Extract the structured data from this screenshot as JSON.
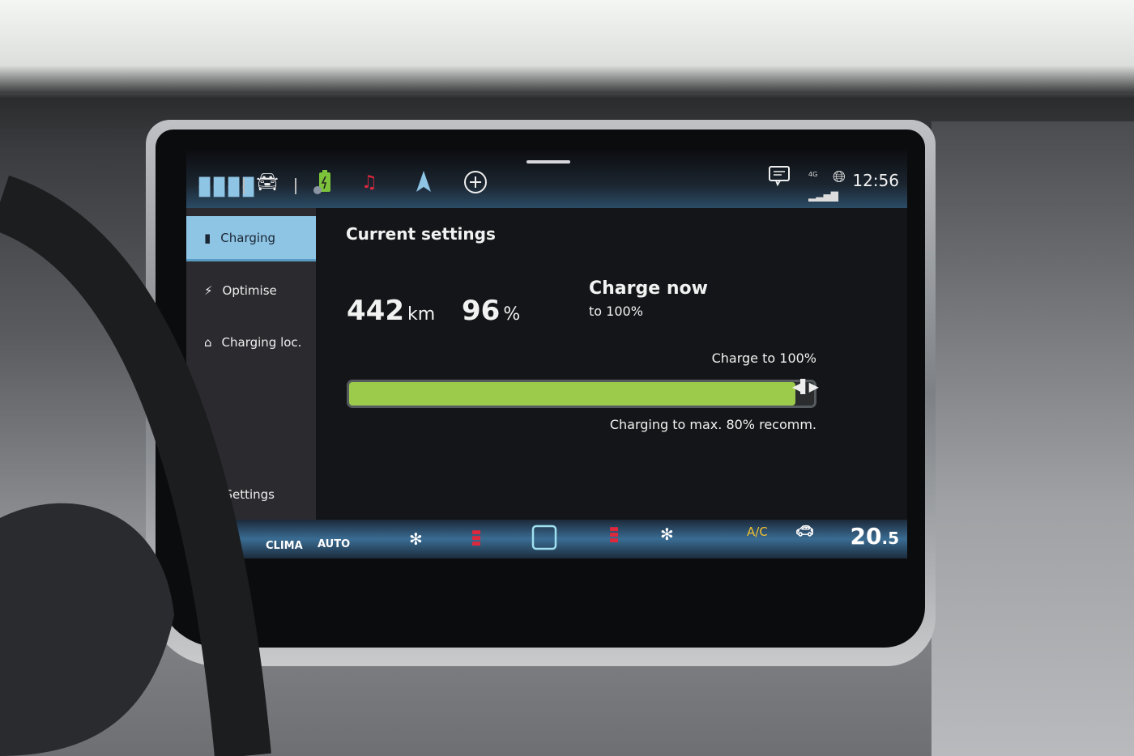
{
  "topbar": {
    "icons": [
      "apps-grid-icon",
      "vehicle-icon",
      "charging-settings-icon",
      "music-icon",
      "navigation-icon",
      "add-icon",
      "messages-icon",
      "signal-4g-icon",
      "connectivity-globe-icon"
    ],
    "network": "4G",
    "time": "12:56"
  },
  "sidebar": {
    "items": [
      {
        "label": "Charging",
        "icon": "battery-charging-icon",
        "active": true
      },
      {
        "label": "Optimise",
        "icon": "charge-optimise-icon"
      },
      {
        "label": "Charging loc.",
        "icon": "charging-location-icon"
      },
      {
        "label": "Settings",
        "icon": "gear-icon"
      }
    ]
  },
  "main": {
    "title": "Current settings",
    "range_value": "442",
    "range_unit": "km",
    "soc_value": "96",
    "soc_unit": "%",
    "charge_now": "Charge now",
    "charge_now_target": "to 100%",
    "target_label": "Charge to 100%",
    "target_percent": 100,
    "battery_percent": 96,
    "recommendation": "Charging to max. 80% recomm."
  },
  "climate": {
    "clima": "CLIMA",
    "auto": "AUTO",
    "ac": "A/C",
    "temp_int": "20",
    "temp_dec": ".5"
  },
  "colors": {
    "accent_blue": "#8ec4e4",
    "charge_green": "#9ccb4b",
    "music_red": "#e0283c",
    "ac_yellow": "#f0c030"
  }
}
